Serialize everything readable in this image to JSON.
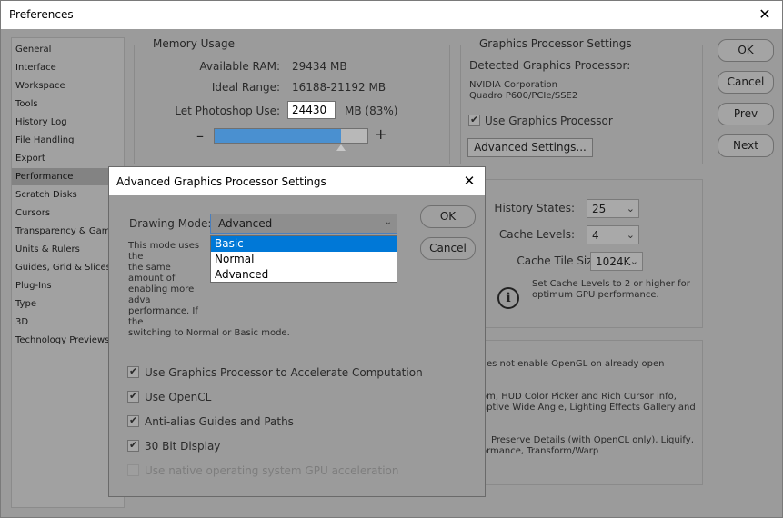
{
  "window": {
    "title": "Preferences",
    "close_glyph": "✕"
  },
  "sidebar": {
    "items": [
      {
        "label": "General"
      },
      {
        "label": "Interface"
      },
      {
        "label": "Workspace"
      },
      {
        "label": "Tools"
      },
      {
        "label": "History Log"
      },
      {
        "label": "File Handling"
      },
      {
        "label": "Export"
      },
      {
        "label": "Performance",
        "active": true
      },
      {
        "label": "Scratch Disks"
      },
      {
        "label": "Cursors"
      },
      {
        "label": "Transparency & Gamut"
      },
      {
        "label": "Units & Rulers"
      },
      {
        "label": "Guides, Grid & Slices"
      },
      {
        "label": "Plug-Ins"
      },
      {
        "label": "Type"
      },
      {
        "label": "3D"
      },
      {
        "label": "Technology Previews"
      }
    ]
  },
  "memory": {
    "title": "Memory Usage",
    "available_label": "Available RAM:",
    "available_value": "29434 MB",
    "ideal_label": "Ideal Range:",
    "ideal_value": "16188-21192 MB",
    "use_label": "Let Photoshop Use:",
    "use_value": "24430",
    "use_suffix": "MB (83%)",
    "minus": "–",
    "plus": "+",
    "usage_fraction": 0.83
  },
  "gpu": {
    "title": "Graphics Processor Settings",
    "detected_label": "Detected Graphics Processor:",
    "vendor": "NVIDIA Corporation",
    "model": "Quadro P600/PCIe/SSE2",
    "use_gpu_label": "Use Graphics Processor",
    "use_gpu_checked": true,
    "advanced_button": "Advanced Settings..."
  },
  "history": {
    "states_label": "History States:",
    "states_value": "25",
    "levels_label": "Cache Levels:",
    "levels_value": "4",
    "tile_label": "Cache Tile Size:",
    "tile_value": "1024K",
    "tip_line1": "Set Cache Levels to 2 or higher for",
    "tip_line2": "optimum GPU performance.",
    "info_glyph": "i"
  },
  "bg_text": {
    "line1": "es not enable OpenGL on already open",
    "line2": "om, HUD Color Picker and Rich Cursor info,",
    "line3": "aptive Wide Angle, Lighting Effects Gallery and",
    "line4": "Preserve Details (with OpenCL only), Liquify,",
    "line5": "ormance, Transform/Warp"
  },
  "buttons": {
    "ok": "OK",
    "cancel": "Cancel",
    "prev": "Prev",
    "next": "Next"
  },
  "dialog": {
    "title": "Advanced Graphics Processor Settings",
    "close_glyph": "✕",
    "mode_label": "Drawing Mode:",
    "mode_value": "Advanced",
    "options": [
      "Basic",
      "Normal",
      "Advanced"
    ],
    "highlighted_option": "Basic",
    "desc_lines": [
      "This mode uses the",
      "the same amount of",
      "enabling more adva",
      "performance.  If the",
      "switching to Normal or Basic mode."
    ],
    "ok": "OK",
    "cancel": "Cancel",
    "checkboxes": [
      {
        "label": "Use Graphics Processor to Accelerate Computation",
        "checked": true,
        "enabled": true
      },
      {
        "label": "Use OpenCL",
        "checked": true,
        "enabled": true
      },
      {
        "label": "Anti-alias Guides and Paths",
        "checked": true,
        "enabled": true
      },
      {
        "label": "30 Bit Display",
        "checked": true,
        "enabled": true
      },
      {
        "label": "Use native operating system GPU acceleration",
        "checked": false,
        "enabled": false
      }
    ]
  },
  "colors": {
    "progress_fill": "#4a90d0",
    "highlight": "#0078d7"
  }
}
